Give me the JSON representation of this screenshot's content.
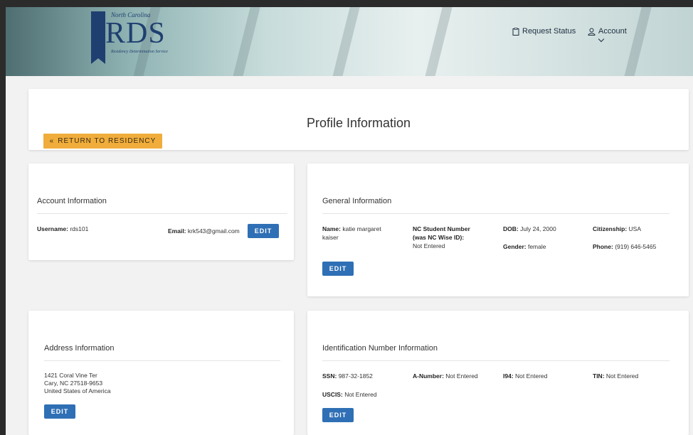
{
  "header": {
    "logo": {
      "top_line": "North Carolina",
      "main": "RDS",
      "sub_line": "Residency Determination Service"
    },
    "nav": {
      "request_status": "Request Status",
      "account": "Account"
    }
  },
  "profile": {
    "title": "Profile Information",
    "return_button": "RETURN TO RESIDENCY"
  },
  "account_info": {
    "title": "Account Information",
    "username_label": "Username:",
    "username_value": "rds101",
    "email_label": "Email:",
    "email_value": "krk543@gmail.com",
    "edit_label": "EDIT"
  },
  "general_info": {
    "title": "General Information",
    "name_label": "Name:",
    "name_value_1": "katie margaret",
    "name_value_2": "kaiser",
    "ncsn_label_1": "NC Student Number",
    "ncsn_label_2": "(was NC Wise ID):",
    "ncsn_value": "Not Entered",
    "dob_label": "DOB:",
    "dob_value": "July 24, 2000",
    "gender_label": "Gender:",
    "gender_value": "female",
    "citizenship_label": "Citizenship:",
    "citizenship_value": "USA",
    "phone_label": "Phone:",
    "phone_value": "(919) 646-5465",
    "edit_label": "EDIT"
  },
  "address_info": {
    "title": "Address Information",
    "line1": "1421 Coral Vine Ter",
    "line2": "Cary, NC 27518-9653",
    "line3": "United States of America",
    "edit_label": "EDIT"
  },
  "id_info": {
    "title": "Identification Number Information",
    "ssn_label": "SSN:",
    "ssn_value": "987-32-1852",
    "anumber_label": "A-Number:",
    "anumber_value": "Not Entered",
    "i94_label": "I94:",
    "i94_value": "Not Entered",
    "tin_label": "TIN:",
    "tin_value": "Not Entered",
    "uscis_label": "USCIS:",
    "uscis_value": "Not Entered",
    "edit_label": "EDIT"
  }
}
